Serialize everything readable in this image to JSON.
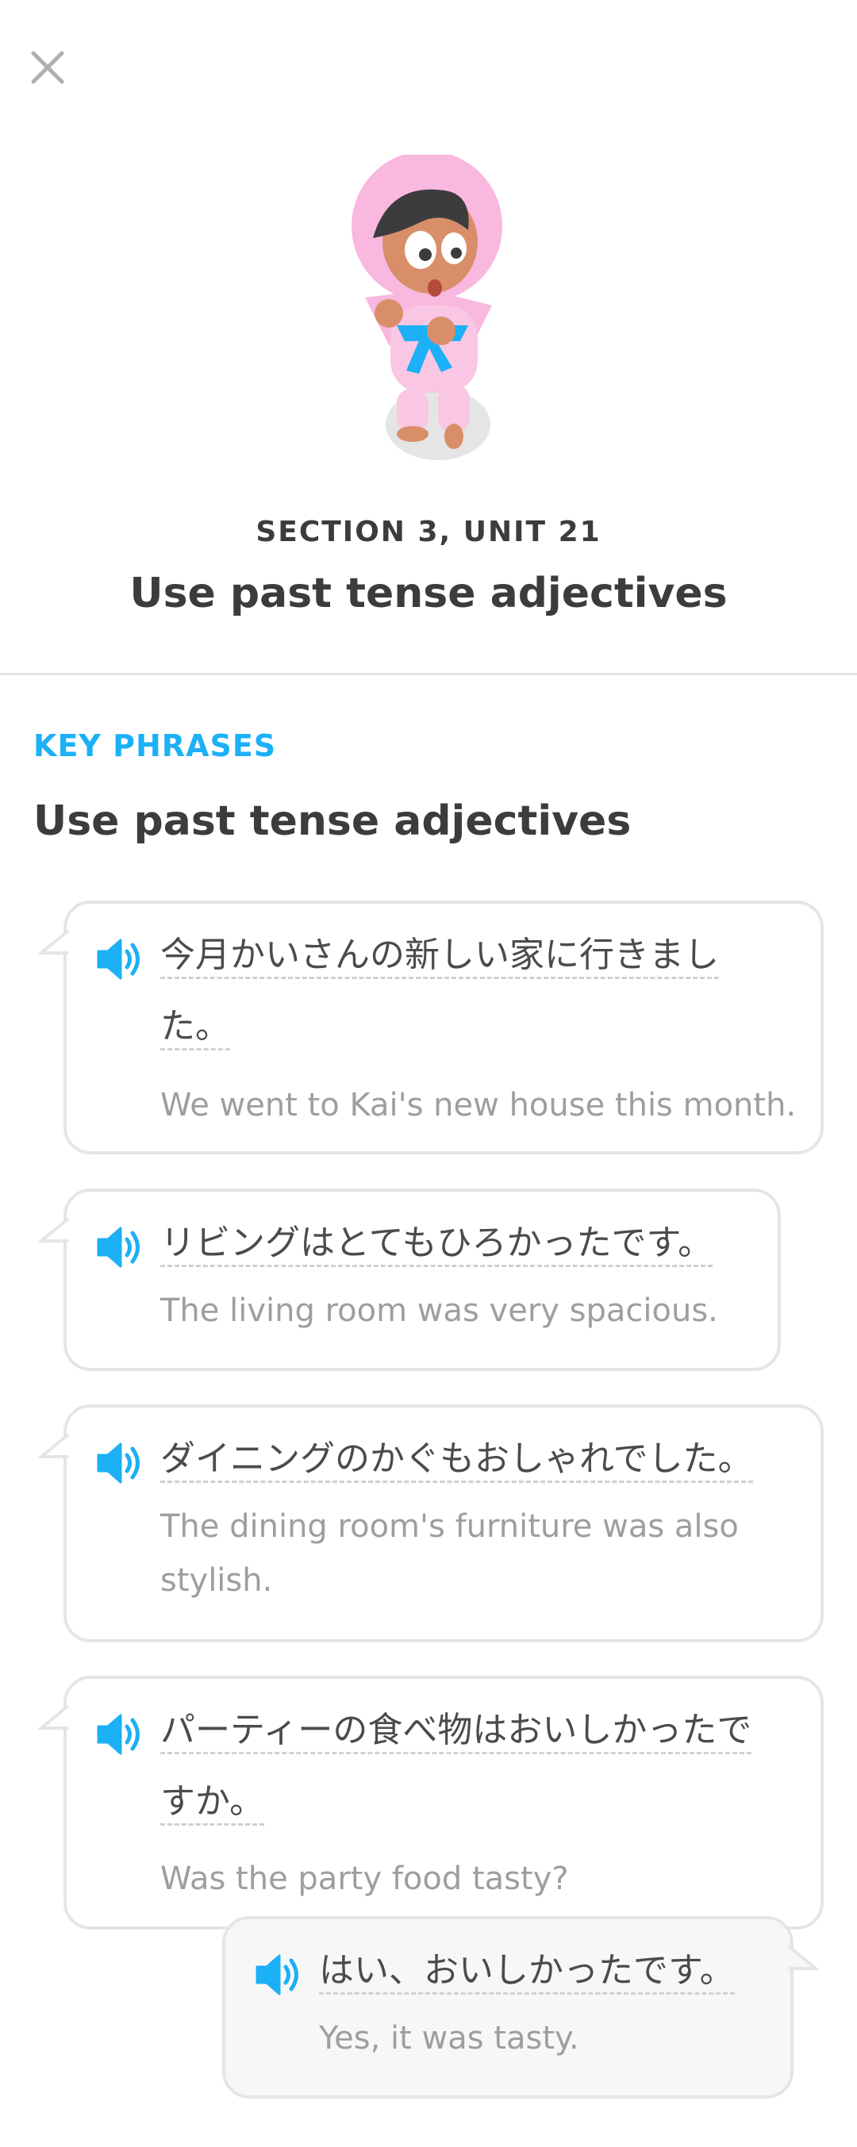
{
  "header": {
    "close_icon": "close-icon",
    "section_label": "SECTION 3, UNIT 21",
    "unit_title": "Use past tense adjectives"
  },
  "key_phrases": {
    "label": "KEY PHRASES",
    "title": "Use past tense adjectives",
    "colors": {
      "accent": "#1cb0f6",
      "border": "#e5e5e5",
      "muted": "#9e9e9e"
    },
    "phrases": [
      {
        "japanese_line1": "今月かいさんの新しい家に行きまし",
        "japanese_line2": "た。",
        "english": "We went to Kai's new house this month.",
        "icon": "speaker-icon"
      },
      {
        "japanese_line1": "リビングはとてもひろかったです。",
        "english": "The living room was very spacious.",
        "icon": "speaker-icon"
      },
      {
        "japanese_line1": "ダイニングのかぐもおしゃれでした。",
        "english_line1": "The dining room's furniture was also",
        "english_line2": "stylish.",
        "icon": "speaker-icon"
      },
      {
        "japanese_line1": "パーティーの食べ物はおいしかったで",
        "japanese_line2": "すか。",
        "english": "Was the party food tasty?",
        "icon": "speaker-icon"
      },
      {
        "japanese_line1": "はい、おいしかったです。",
        "english": "Yes, it was tasty.",
        "icon": "speaker-icon"
      }
    ]
  }
}
